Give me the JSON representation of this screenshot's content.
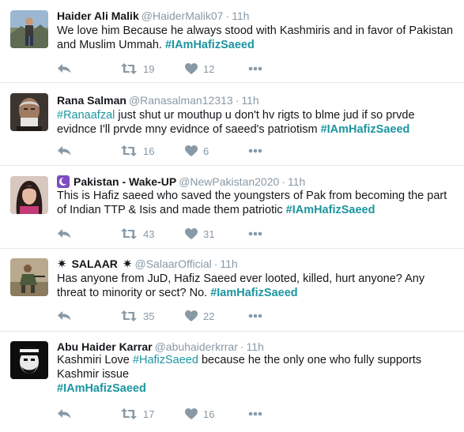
{
  "tweets": [
    {
      "name": "Haider Ali Malik",
      "handle": "@HaiderMalik07",
      "time": "11h",
      "text_a": "We love him Because he always stood with Kashmiris and in favor of Pakistan and Muslim Ummah. ",
      "tag_a": "#IAmHafizSaeed",
      "retweets": "19",
      "likes": "12"
    },
    {
      "name": "Rana Salman",
      "handle": "@Ranasalman12313",
      "time": "11h",
      "tag_a": "#Ranaafzal",
      "text_a": " just shut ur mouthup u don't hv rigts to blme jud if so prvde evidnce I'll prvde mny evidnce of saeed's patriotism ",
      "tag_b": "#IAmHafizSaeed",
      "retweets": "16",
      "likes": "6"
    },
    {
      "name": "Pakistan - Wake-UP",
      "handle": "@NewPakistan2020",
      "time": "11h",
      "text_a": "This is Hafiz saeed who saved the youngsters of Pak from becoming the part of Indian TTP & Isis and made them patriotic ",
      "tag_a": "#IAmHafizSaeed",
      "retweets": "43",
      "likes": "31"
    },
    {
      "name": "SALAAR",
      "name_prefix": "✷",
      "name_suffix": "✷",
      "handle": "@SalaarOfficial",
      "time": "11h",
      "text_a": "Has anyone from JuD, Hafiz Saeed ever looted, killed, hurt anyone? Any threat to minority or sect? No.  ",
      "tag_a": "#IamHafizSaeed",
      "retweets": "35",
      "likes": "22"
    },
    {
      "name": "Abu Haider Karrar",
      "handle": "@abuhaiderkrrar",
      "time": "11h",
      "text_a": "Kashmiri Love ",
      "tag_a": "#HafizSaeed",
      "text_b": " because he the only one who fully supports Kashmir issue",
      "tag_b": "#IAmHafizSaeed",
      "retweets": "17",
      "likes": "16"
    }
  ],
  "separator": "·",
  "icons": {
    "reply": "reply-icon",
    "retweet": "retweet-icon",
    "like": "heart-icon",
    "more": "more-icon",
    "badge": "crescent-badge-icon"
  },
  "colors": {
    "hashtag": "#1b95a0",
    "muted": "#8899a6",
    "divider": "#e1e8ed",
    "badge": "#7e4dbf"
  }
}
